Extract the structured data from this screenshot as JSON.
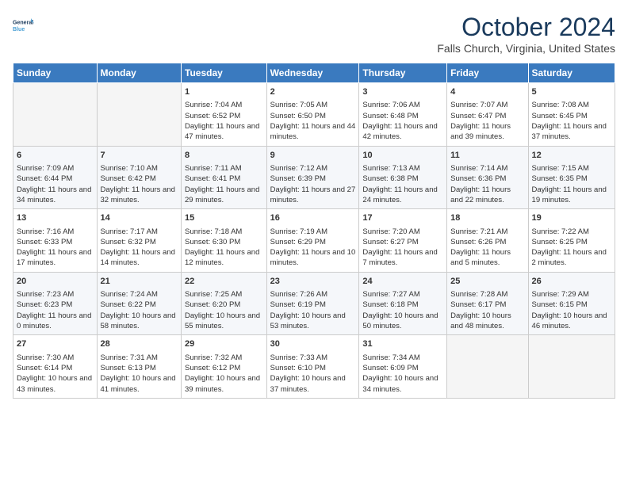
{
  "header": {
    "logo_line1": "General",
    "logo_line2": "Blue",
    "month_title": "October 2024",
    "location": "Falls Church, Virginia, United States"
  },
  "days_of_week": [
    "Sunday",
    "Monday",
    "Tuesday",
    "Wednesday",
    "Thursday",
    "Friday",
    "Saturday"
  ],
  "weeks": [
    [
      {
        "day": "",
        "empty": true
      },
      {
        "day": "",
        "empty": true
      },
      {
        "day": "1",
        "sunrise": "Sunrise: 7:04 AM",
        "sunset": "Sunset: 6:52 PM",
        "daylight": "Daylight: 11 hours and 47 minutes."
      },
      {
        "day": "2",
        "sunrise": "Sunrise: 7:05 AM",
        "sunset": "Sunset: 6:50 PM",
        "daylight": "Daylight: 11 hours and 44 minutes."
      },
      {
        "day": "3",
        "sunrise": "Sunrise: 7:06 AM",
        "sunset": "Sunset: 6:48 PM",
        "daylight": "Daylight: 11 hours and 42 minutes."
      },
      {
        "day": "4",
        "sunrise": "Sunrise: 7:07 AM",
        "sunset": "Sunset: 6:47 PM",
        "daylight": "Daylight: 11 hours and 39 minutes."
      },
      {
        "day": "5",
        "sunrise": "Sunrise: 7:08 AM",
        "sunset": "Sunset: 6:45 PM",
        "daylight": "Daylight: 11 hours and 37 minutes."
      }
    ],
    [
      {
        "day": "6",
        "sunrise": "Sunrise: 7:09 AM",
        "sunset": "Sunset: 6:44 PM",
        "daylight": "Daylight: 11 hours and 34 minutes."
      },
      {
        "day": "7",
        "sunrise": "Sunrise: 7:10 AM",
        "sunset": "Sunset: 6:42 PM",
        "daylight": "Daylight: 11 hours and 32 minutes."
      },
      {
        "day": "8",
        "sunrise": "Sunrise: 7:11 AM",
        "sunset": "Sunset: 6:41 PM",
        "daylight": "Daylight: 11 hours and 29 minutes."
      },
      {
        "day": "9",
        "sunrise": "Sunrise: 7:12 AM",
        "sunset": "Sunset: 6:39 PM",
        "daylight": "Daylight: 11 hours and 27 minutes."
      },
      {
        "day": "10",
        "sunrise": "Sunrise: 7:13 AM",
        "sunset": "Sunset: 6:38 PM",
        "daylight": "Daylight: 11 hours and 24 minutes."
      },
      {
        "day": "11",
        "sunrise": "Sunrise: 7:14 AM",
        "sunset": "Sunset: 6:36 PM",
        "daylight": "Daylight: 11 hours and 22 minutes."
      },
      {
        "day": "12",
        "sunrise": "Sunrise: 7:15 AM",
        "sunset": "Sunset: 6:35 PM",
        "daylight": "Daylight: 11 hours and 19 minutes."
      }
    ],
    [
      {
        "day": "13",
        "sunrise": "Sunrise: 7:16 AM",
        "sunset": "Sunset: 6:33 PM",
        "daylight": "Daylight: 11 hours and 17 minutes."
      },
      {
        "day": "14",
        "sunrise": "Sunrise: 7:17 AM",
        "sunset": "Sunset: 6:32 PM",
        "daylight": "Daylight: 11 hours and 14 minutes."
      },
      {
        "day": "15",
        "sunrise": "Sunrise: 7:18 AM",
        "sunset": "Sunset: 6:30 PM",
        "daylight": "Daylight: 11 hours and 12 minutes."
      },
      {
        "day": "16",
        "sunrise": "Sunrise: 7:19 AM",
        "sunset": "Sunset: 6:29 PM",
        "daylight": "Daylight: 11 hours and 10 minutes."
      },
      {
        "day": "17",
        "sunrise": "Sunrise: 7:20 AM",
        "sunset": "Sunset: 6:27 PM",
        "daylight": "Daylight: 11 hours and 7 minutes."
      },
      {
        "day": "18",
        "sunrise": "Sunrise: 7:21 AM",
        "sunset": "Sunset: 6:26 PM",
        "daylight": "Daylight: 11 hours and 5 minutes."
      },
      {
        "day": "19",
        "sunrise": "Sunrise: 7:22 AM",
        "sunset": "Sunset: 6:25 PM",
        "daylight": "Daylight: 11 hours and 2 minutes."
      }
    ],
    [
      {
        "day": "20",
        "sunrise": "Sunrise: 7:23 AM",
        "sunset": "Sunset: 6:23 PM",
        "daylight": "Daylight: 11 hours and 0 minutes."
      },
      {
        "day": "21",
        "sunrise": "Sunrise: 7:24 AM",
        "sunset": "Sunset: 6:22 PM",
        "daylight": "Daylight: 10 hours and 58 minutes."
      },
      {
        "day": "22",
        "sunrise": "Sunrise: 7:25 AM",
        "sunset": "Sunset: 6:20 PM",
        "daylight": "Daylight: 10 hours and 55 minutes."
      },
      {
        "day": "23",
        "sunrise": "Sunrise: 7:26 AM",
        "sunset": "Sunset: 6:19 PM",
        "daylight": "Daylight: 10 hours and 53 minutes."
      },
      {
        "day": "24",
        "sunrise": "Sunrise: 7:27 AM",
        "sunset": "Sunset: 6:18 PM",
        "daylight": "Daylight: 10 hours and 50 minutes."
      },
      {
        "day": "25",
        "sunrise": "Sunrise: 7:28 AM",
        "sunset": "Sunset: 6:17 PM",
        "daylight": "Daylight: 10 hours and 48 minutes."
      },
      {
        "day": "26",
        "sunrise": "Sunrise: 7:29 AM",
        "sunset": "Sunset: 6:15 PM",
        "daylight": "Daylight: 10 hours and 46 minutes."
      }
    ],
    [
      {
        "day": "27",
        "sunrise": "Sunrise: 7:30 AM",
        "sunset": "Sunset: 6:14 PM",
        "daylight": "Daylight: 10 hours and 43 minutes."
      },
      {
        "day": "28",
        "sunrise": "Sunrise: 7:31 AM",
        "sunset": "Sunset: 6:13 PM",
        "daylight": "Daylight: 10 hours and 41 minutes."
      },
      {
        "day": "29",
        "sunrise": "Sunrise: 7:32 AM",
        "sunset": "Sunset: 6:12 PM",
        "daylight": "Daylight: 10 hours and 39 minutes."
      },
      {
        "day": "30",
        "sunrise": "Sunrise: 7:33 AM",
        "sunset": "Sunset: 6:10 PM",
        "daylight": "Daylight: 10 hours and 37 minutes."
      },
      {
        "day": "31",
        "sunrise": "Sunrise: 7:34 AM",
        "sunset": "Sunset: 6:09 PM",
        "daylight": "Daylight: 10 hours and 34 minutes."
      },
      {
        "day": "",
        "empty": true
      },
      {
        "day": "",
        "empty": true
      }
    ]
  ]
}
